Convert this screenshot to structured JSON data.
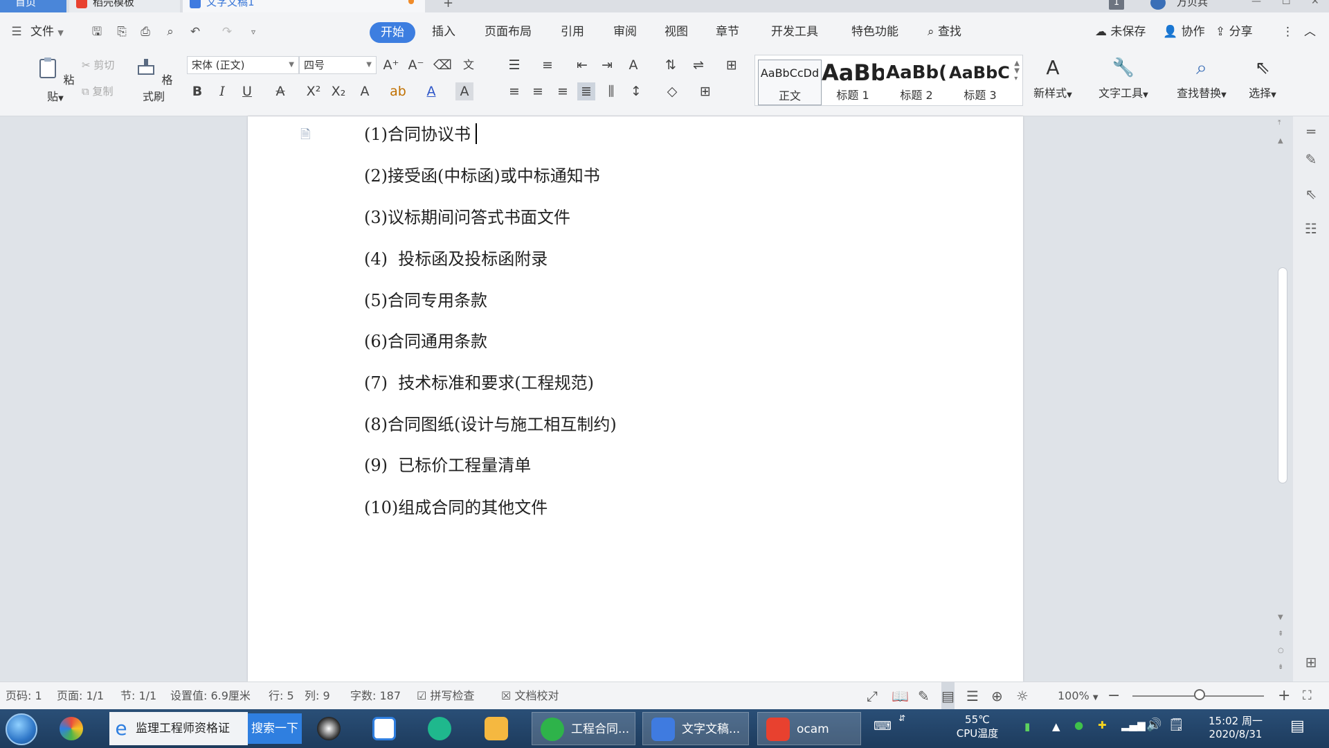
{
  "top_tabs": [
    {
      "label": "首页"
    },
    {
      "label": "稻壳模板"
    },
    {
      "label": "文字文稿1"
    }
  ],
  "window": {
    "user_count": "1",
    "user_name": "万贝兵"
  },
  "menu": {
    "file": "文件",
    "tabs": [
      "开始",
      "插入",
      "页面布局",
      "引用",
      "审阅",
      "视图",
      "章节",
      "开发工具",
      "特色功能"
    ],
    "search": "查找",
    "right": [
      "未保存",
      "协作",
      "分享"
    ]
  },
  "ribbon": {
    "paste": "粘贴",
    "cut": "剪切",
    "copy": "复制",
    "format_painter": "格式刷",
    "font_name": "宋体 (正文)",
    "font_size": "四号",
    "styles": [
      {
        "preview": "AaBbCcDd",
        "label": "正文"
      },
      {
        "preview": "AaBb",
        "label": "标题 1"
      },
      {
        "preview": "AaBb(",
        "label": "标题 2"
      },
      {
        "preview": "AaBbC(",
        "label": "标题 3"
      }
    ],
    "new_style": "新样式",
    "text_tools": "文字工具",
    "find_replace": "查找替换",
    "select": "选择"
  },
  "document": {
    "lines": [
      "(1)合同协议书",
      "(2)接受函(中标函)或中标通知书",
      "(3)议标期间问答式书面文件",
      "(4)  投标函及投标函附录",
      "(5)合同专用条款",
      "(6)合同通用条款",
      "(7)  技术标准和要求(工程规范)",
      "(8)合同图纸(设计与施工相互制约)",
      "(9)  已标价工程量清单",
      "(10)组成合同的其他文件"
    ]
  },
  "status": {
    "page_code": "页码: 1",
    "page": "页面: 1/1",
    "section": "节: 1/1",
    "setting": "设置值: 6.9厘米",
    "row": "行: 5",
    "col": "列: 9",
    "words": "字数: 187",
    "spell": "拼写检查",
    "proof": "文档校对",
    "zoom": "100%"
  },
  "taskbar": {
    "ie_title": "监理工程师资格证",
    "search_button": "搜索一下",
    "apps": [
      "工程合同...",
      "文字文稿...",
      "ocam"
    ],
    "cpu_temp": "55℃",
    "cpu_label": "CPU温度",
    "time": "15:02 周一",
    "date": "2020/8/31"
  },
  "colors": {
    "accent": "#3d7ee0",
    "taskbar": "#1d3b5d"
  }
}
